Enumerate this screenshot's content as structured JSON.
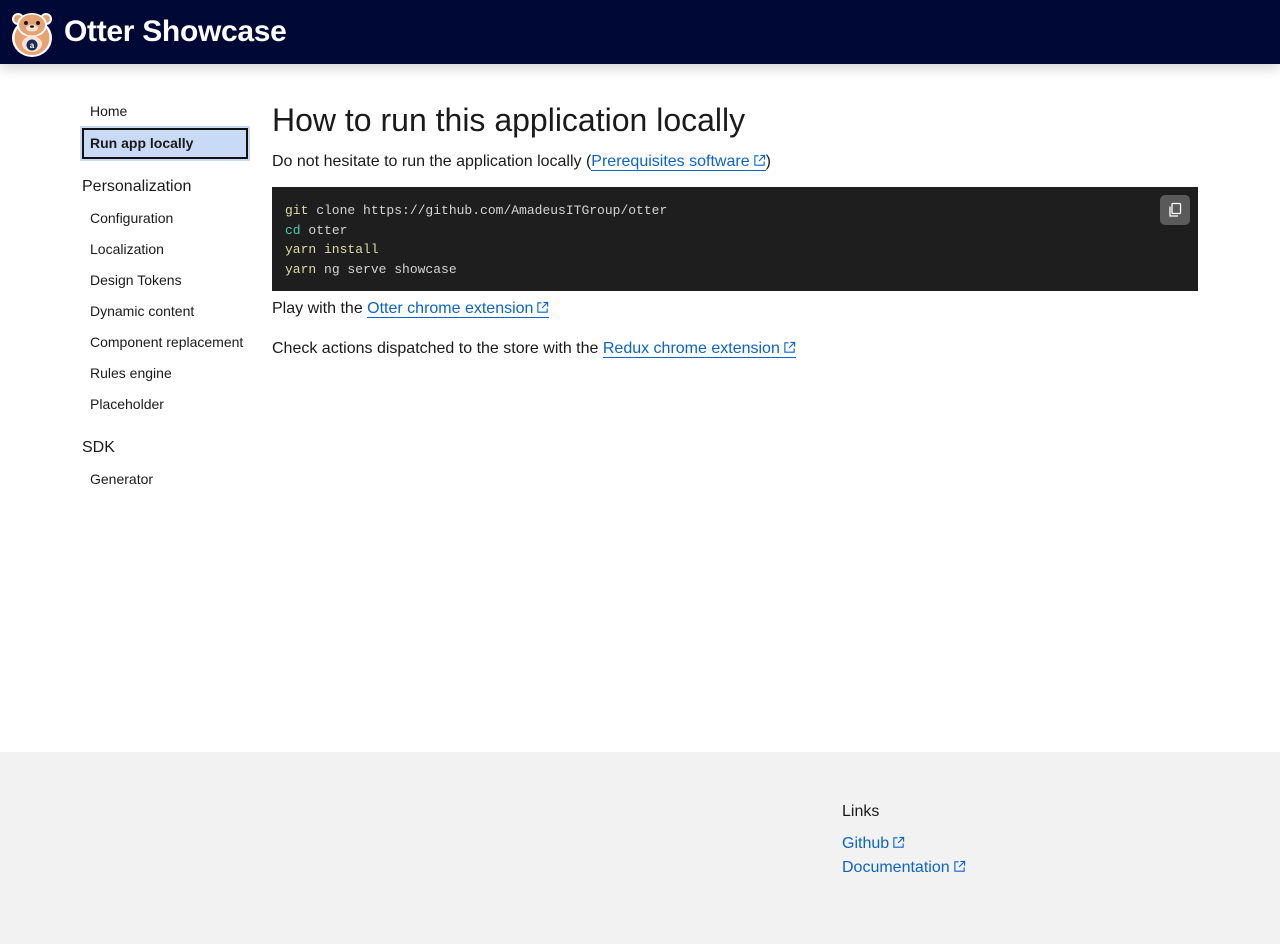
{
  "header": {
    "title": "Otter Showcase",
    "logo_icon": "otter-logo-icon"
  },
  "sidebar": {
    "items": [
      {
        "label": "Home"
      },
      {
        "label": "Run app locally",
        "active": true
      }
    ],
    "sections": [
      {
        "title": "Personalization",
        "items": [
          {
            "label": "Configuration"
          },
          {
            "label": "Localization"
          },
          {
            "label": "Design Tokens"
          },
          {
            "label": "Dynamic content"
          },
          {
            "label": "Component replacement"
          },
          {
            "label": "Rules engine"
          },
          {
            "label": "Placeholder"
          }
        ]
      },
      {
        "title": "SDK",
        "items": [
          {
            "label": "Generator"
          }
        ]
      }
    ]
  },
  "main": {
    "title": "How to run this application locally",
    "intro_before": "Do not hesitate to run the application locally (",
    "intro_link": "Prerequisites software",
    "intro_after": ")",
    "code": {
      "lines": [
        {
          "cmd": "git",
          "rest": " clone https://github.com/AmadeusITGroup/otter"
        },
        {
          "cmd": "cd",
          "rest": " otter"
        },
        {
          "cmd": "yarn install",
          "rest": ""
        },
        {
          "cmd": "yarn",
          "rest": " ng serve showcase"
        }
      ],
      "copy_icon": "copy-icon"
    },
    "play_before": "Play with the ",
    "play_link": "Otter chrome extension",
    "check_before": "Check actions dispatched to the store with the ",
    "check_link": "Redux chrome extension"
  },
  "footer": {
    "heading": "Links",
    "links": [
      {
        "label": "Github"
      },
      {
        "label": "Documentation"
      }
    ]
  },
  "colors": {
    "header_bg": "#000835",
    "link": "#0b63ce",
    "active_bg": "#c9daf7",
    "code_bg": "#1e1e1e",
    "footer_bg": "#f2f2f2"
  }
}
